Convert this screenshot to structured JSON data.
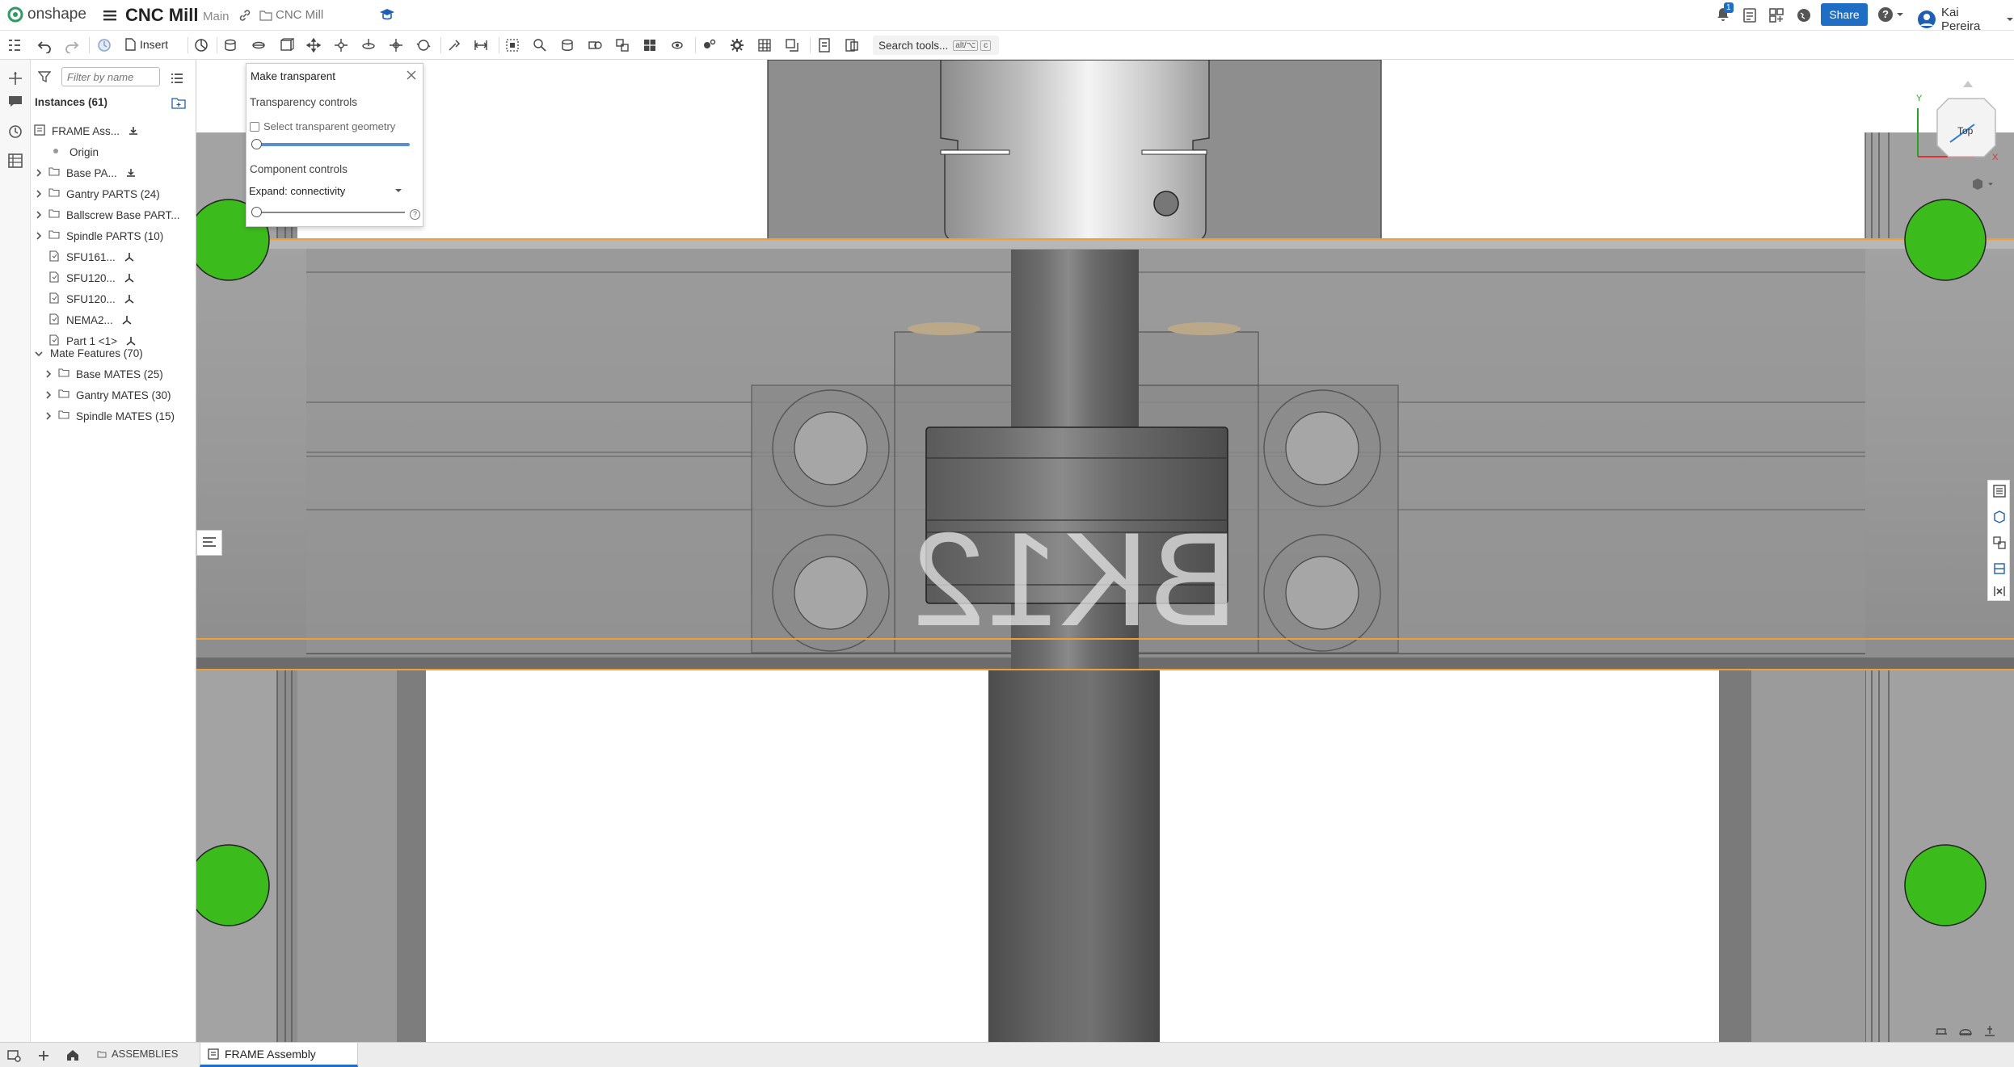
{
  "header": {
    "brand": "onshape",
    "doc_title": "CNC Mill",
    "branch": "Main",
    "folder": "CNC Mill",
    "notification_count": "1",
    "share_label": "Share",
    "help_label": "?",
    "user_name": "Kai Pereira"
  },
  "toolbar": {
    "insert_label": "Insert",
    "search_label": "Search tools...",
    "search_shortcut_mod": "alt/⌥",
    "search_shortcut_key": "c"
  },
  "tree": {
    "filter_placeholder": "Filter by name",
    "instances_label": "Instances (61)",
    "items": [
      {
        "label": "FRAME Ass...",
        "kind": "assembly"
      },
      {
        "label": "Origin",
        "kind": "origin"
      },
      {
        "label": "Base PA...",
        "kind": "folder"
      },
      {
        "label": "Gantry PARTS (24)",
        "kind": "folder"
      },
      {
        "label": "Ballscrew Base PART...",
        "kind": "folder"
      },
      {
        "label": "Spindle PARTS (10)",
        "kind": "folder"
      },
      {
        "label": "SFU161...",
        "kind": "part"
      },
      {
        "label": "SFU120...",
        "kind": "part"
      },
      {
        "label": "SFU120...",
        "kind": "part"
      },
      {
        "label": "NEMA2...",
        "kind": "part"
      },
      {
        "label": "Part 1 <1>",
        "kind": "part"
      }
    ],
    "mate_features_label": "Mate Features (70)",
    "mate_items": [
      {
        "label": "Base MATES (25)"
      },
      {
        "label": "Gantry MATES (30)"
      },
      {
        "label": "Spindle MATES (15)"
      }
    ]
  },
  "transparent_panel": {
    "title": "Make transparent",
    "transparency_heading": "Transparency controls",
    "checkbox_label": "Select transparent geometry",
    "slider1_value": 0,
    "component_heading": "Component controls",
    "expand_value": "Expand: connectivity",
    "slider2_value": 0
  },
  "viewcube": {
    "face_label": "Top",
    "axis_y": "Y",
    "axis_x": "X"
  },
  "viewport": {
    "part_engraving": "BK12"
  },
  "tabs": {
    "assemblies_label": "ASSEMBLIES",
    "active_tab_label": "FRAME Assembly"
  },
  "colors": {
    "share": "#1e6fc4",
    "accent_orange": "#f0a030",
    "marker_green": "#3cbc1c",
    "frame_gray": "#9a9a9a"
  }
}
